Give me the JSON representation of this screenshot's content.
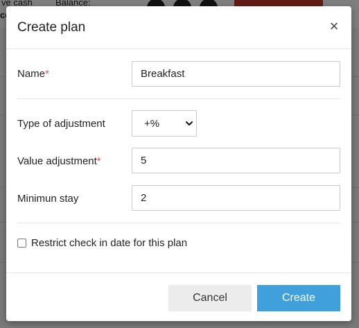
{
  "background": {
    "text_1": "ve cash",
    "text_2": "Balance:",
    "text_3": "ce"
  },
  "modal": {
    "title": "Create plan",
    "close_icon": "×",
    "fields": {
      "name": {
        "label": "Name",
        "required_mark": "*",
        "value": "Breakfast"
      },
      "adjustment_type": {
        "label": "Type of adjustment",
        "selected": "+%"
      },
      "value_adjustment": {
        "label": "Value adjustment",
        "required_mark": "*",
        "value": "5"
      },
      "minimum_stay": {
        "label": "Minimun stay",
        "value": "2"
      }
    },
    "restrict_checkbox": {
      "label": "Restrict check in date for this plan",
      "checked": false
    },
    "buttons": {
      "cancel": "Cancel",
      "create": "Create"
    }
  },
  "colors": {
    "primary": "#3fa0db",
    "required": "#d9534f",
    "cancel_bg": "#ececec"
  }
}
